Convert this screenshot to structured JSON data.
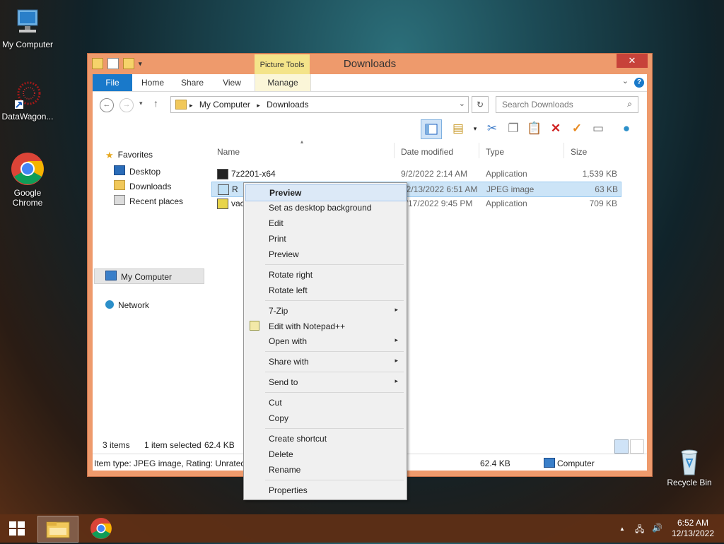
{
  "desktop": {
    "icons": [
      {
        "label": "My Computer"
      },
      {
        "label": "DataWagon..."
      },
      {
        "label": "Google Chrome"
      },
      {
        "label": "Recycle Bin"
      }
    ]
  },
  "window": {
    "title": "Downloads",
    "contextual_tab_group": "Picture Tools",
    "close_glyph": "✕",
    "tabs": [
      {
        "label": "File"
      },
      {
        "label": "Home"
      },
      {
        "label": "Share"
      },
      {
        "label": "View"
      },
      {
        "label": "Manage"
      }
    ],
    "help_glyph": "?",
    "address": {
      "crumbs": [
        "My Computer",
        "Downloads"
      ],
      "separator": "▸"
    },
    "search_placeholder": "Search Downloads",
    "nav": {
      "favorites": "Favorites",
      "desktop": "Desktop",
      "downloads": "Downloads",
      "recent": "Recent places",
      "my_computer": "My Computer",
      "network": "Network"
    },
    "columns": {
      "name": "Name",
      "date": "Date modified",
      "type": "Type",
      "size": "Size"
    },
    "files": [
      {
        "name": "7z2201-x64",
        "date": "9/2/2022 2:14 AM",
        "type": "Application",
        "size": "1,539 KB"
      },
      {
        "name": "R",
        "date": "12/13/2022 6:51 AM",
        "type": "JPEG image",
        "size": "63 KB"
      },
      {
        "name": "vac",
        "date": "0/17/2022 9:45 PM",
        "type": "Application",
        "size": "709 KB"
      }
    ],
    "status": {
      "item_count": "3 items",
      "selection": "1 item selected",
      "selection_size": "62.4 KB"
    },
    "details": {
      "info": "Item type: JPEG image, Rating: Unrated,",
      "size": "62.4 KB",
      "location": "Computer"
    }
  },
  "context_menu": {
    "items": [
      {
        "label": "Preview",
        "highlight": true
      },
      {
        "label": "Set as desktop background"
      },
      {
        "label": "Edit"
      },
      {
        "label": "Print"
      },
      {
        "label": "Preview"
      },
      {
        "label": "Rotate right"
      },
      {
        "label": "Rotate left"
      },
      {
        "label": "7-Zip",
        "submenu": true
      },
      {
        "label": "Edit with Notepad++",
        "icon": "notepad-plus-icon"
      },
      {
        "label": "Open with",
        "submenu": true
      },
      {
        "label": "Share with",
        "submenu": true
      },
      {
        "label": "Send to",
        "submenu": true
      },
      {
        "label": "Cut"
      },
      {
        "label": "Copy"
      },
      {
        "label": "Create shortcut"
      },
      {
        "label": "Delete"
      },
      {
        "label": "Rename"
      },
      {
        "label": "Properties"
      }
    ],
    "submenu_arrow": "▸"
  },
  "taskbar": {
    "time": "6:52 AM",
    "date": "12/13/2022",
    "tray_arrow": "▲"
  },
  "colors": {
    "window_frame": "#ee9a6c",
    "file_tab": "#1979ca",
    "picture_tools": "#f4e48a",
    "close_button": "#c7423a",
    "selection": "#cce4f7",
    "taskbar": "#5f3016"
  }
}
